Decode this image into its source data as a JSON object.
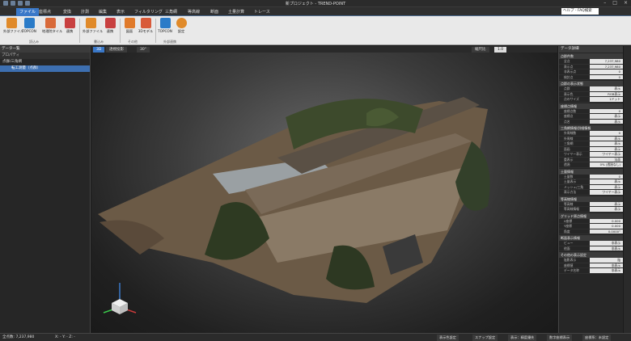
{
  "window": {
    "title": "新プロジェクト - TREND-POINT"
  },
  "menu": {
    "tabs": [
      "ファイル",
      "座標点",
      "変換",
      "計測",
      "編集",
      "表示",
      "フィルタリング",
      "三角網",
      "等高線",
      "断面",
      "土量計算",
      "トレース"
    ],
    "help_placeholder": "ヘルプ - FAQ検索"
  },
  "ribbon": {
    "buttons": [
      "外部ファイル",
      "TOPCON",
      "地理院タイル",
      "連携",
      "外部ファイル",
      "連携",
      "図面",
      "3Dモデル",
      "TOPCON",
      "設定"
    ],
    "groups": [
      "読込み",
      "書込み",
      "その他",
      "外部連携"
    ]
  },
  "left_panel": {
    "title": "データ一覧",
    "toolbar_label": "プロパティ",
    "items": [
      "点群/三角網",
      "転工測量（点群）"
    ]
  },
  "viewport": {
    "tabs": [
      "3D",
      "透視投影",
      "30°"
    ],
    "scale_label": "縮尺比",
    "scale_value": "1.0"
  },
  "right_panel": {
    "title": "データ詳細",
    "sections": [
      {
        "name": "点群件数",
        "rows": [
          [
            "全点",
            "7,237,980"
          ],
          [
            "表示点",
            "7,237,980"
          ],
          [
            "非表示点",
            "0"
          ],
          [
            "検討点",
            "0"
          ]
        ]
      },
      {
        "name": "点群の表示状態",
        "rows": [
          [
            "点群",
            "表示"
          ],
          [
            "表示色",
            "RGB表示"
          ],
          [
            "点のサイズ",
            "1ドット"
          ]
        ]
      },
      {
        "name": "座標点情報",
        "rows": [
          [
            "座標点数",
            "0"
          ],
          [
            "座標点",
            "表示"
          ],
          [
            "点名",
            "表示"
          ]
        ]
      },
      {
        "name": "三角網情報/詳細情報",
        "rows": [
          [
            "外周線数",
            "0"
          ],
          [
            "外周線",
            "表示"
          ],
          [
            "三角網",
            "表示"
          ],
          [
            "面画",
            "表示"
          ],
          [
            "ワイヤー表示",
            "ワイヤー表示"
          ],
          [
            "重表示",
            "法面"
          ],
          [
            "透過",
            "0% (透過なし)"
          ]
        ]
      },
      {
        "name": "土量情報",
        "rows": [
          [
            "土量数",
            "0"
          ],
          [
            "土量表示",
            "表示"
          ],
          [
            "メッシュ/三角",
            "表示"
          ],
          [
            "表示方法",
            "ワイヤー表示"
          ]
        ]
      },
      {
        "name": "等高線情報",
        "rows": [
          [
            "等高線",
            "表示"
          ],
          [
            "等高線情報",
            "表示"
          ]
        ]
      },
      {
        "name": "グリッド原点情報",
        "rows": [
          [
            "X座標",
            "0.000"
          ],
          [
            "Y座標",
            "0.000"
          ],
          [
            "角度",
            "0.0000°"
          ]
        ]
      },
      {
        "name": "断面表示情報",
        "rows": [
          [
            "ビュー",
            "非表示"
          ],
          [
            "他面",
            "非表示"
          ]
        ]
      },
      {
        "name": "その他の表示設定",
        "rows": [
          [
            "陰影表示",
            "陰"
          ],
          [
            "座標値",
            "非表示"
          ],
          [
            "データ名称",
            "非表示"
          ]
        ]
      }
    ]
  },
  "status": {
    "total_points": "全点数: 7,237,980",
    "coords": "X: - Y: - Z: -",
    "buttons": [
      "表示色設定",
      "スナップ設定",
      "表示：精度優先",
      "数字座標表示",
      "座標系：未設定"
    ]
  }
}
